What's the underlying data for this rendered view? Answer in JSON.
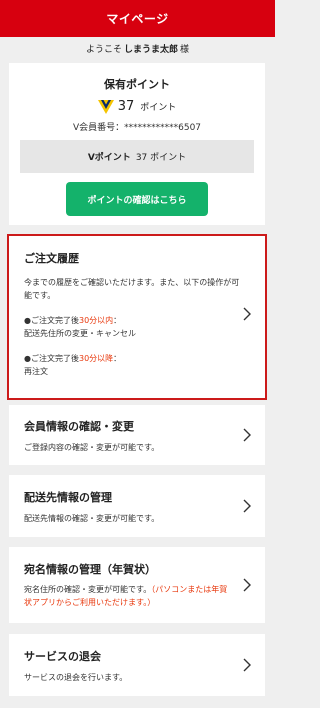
{
  "header": {
    "title": "マイページ"
  },
  "welcome": {
    "prefix": "ようこそ",
    "name": "しまうま太郎",
    "suffix": "様"
  },
  "points": {
    "title": "保有ポイント",
    "amount": "37",
    "unit": "ポイント",
    "member_no_label": "V会員番号：************6507",
    "vpoint_label": "Vポイント",
    "vpoint_value": "37 ポイント",
    "confirm_button": "ポイントの確認はこちら"
  },
  "order_history": {
    "title": "ご注文履歴",
    "desc": "今までの履歴をご確認いただけます。また、以下の操作が可能です。",
    "within_prefix": "●ご注文完了後",
    "within_highlight": "30分以内",
    "within_suffix": "：",
    "within_action": "配送先住所の変更・キャンセル",
    "after_prefix": "●ご注文完了後",
    "after_highlight": "30分以降",
    "after_suffix": "：",
    "after_action": "再注文"
  },
  "member_info": {
    "title": "会員情報の確認・変更",
    "desc": "ご登録内容の確認・変更が可能です。"
  },
  "delivery": {
    "title": "配送先情報の管理",
    "desc": "配送先情報の確認・変更が可能です。"
  },
  "address": {
    "title": "宛名情報の管理（年賀状）",
    "desc": "宛名住所の確認・変更が可能です。",
    "note": "（パソコンまたは年賀状アプリからご利用いただけます。）"
  },
  "withdraw": {
    "title": "サービスの退会",
    "desc": "サービスの退会を行います。"
  },
  "colors": {
    "brand": "#d7000f",
    "button": "#14b26b",
    "highlight": "#e8380d"
  }
}
